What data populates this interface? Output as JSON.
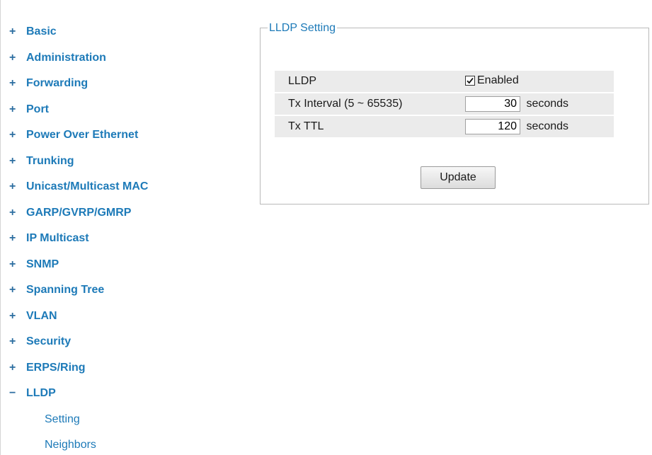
{
  "sidebar": {
    "items": [
      {
        "sign": "+",
        "label": "Basic"
      },
      {
        "sign": "+",
        "label": "Administration"
      },
      {
        "sign": "+",
        "label": "Forwarding"
      },
      {
        "sign": "+",
        "label": "Port"
      },
      {
        "sign": "+",
        "label": "Power Over Ethernet"
      },
      {
        "sign": "+",
        "label": "Trunking"
      },
      {
        "sign": "+",
        "label": "Unicast/Multicast MAC"
      },
      {
        "sign": "+",
        "label": "GARP/GVRP/GMRP"
      },
      {
        "sign": "+",
        "label": "IP Multicast"
      },
      {
        "sign": "+",
        "label": "SNMP"
      },
      {
        "sign": "+",
        "label": "Spanning Tree"
      },
      {
        "sign": "+",
        "label": "VLAN"
      },
      {
        "sign": "+",
        "label": "Security"
      },
      {
        "sign": "+",
        "label": "ERPS/Ring"
      },
      {
        "sign": "−",
        "label": "LLDP"
      }
    ],
    "subitems": [
      {
        "label": "Setting"
      },
      {
        "label": "Neighbors"
      }
    ]
  },
  "lldp_setting": {
    "legend": "LLDP Setting",
    "rows": {
      "lldp": {
        "label": "LLDP",
        "checked": true,
        "value_label": "Enabled"
      },
      "tx_interval": {
        "label": "Tx Interval (5 ~ 65535)",
        "value": "30",
        "unit": "seconds"
      },
      "tx_ttl": {
        "label": "Tx TTL",
        "value": "120",
        "unit": "seconds"
      }
    },
    "update_label": "Update"
  },
  "colors": {
    "link": "#1d7ab8",
    "row_bg": "#ebebeb",
    "border": "#b9b9b9"
  },
  "icons": {
    "expand": "plus-icon",
    "collapse": "minus-icon",
    "checkbox": "checkmark-icon"
  }
}
